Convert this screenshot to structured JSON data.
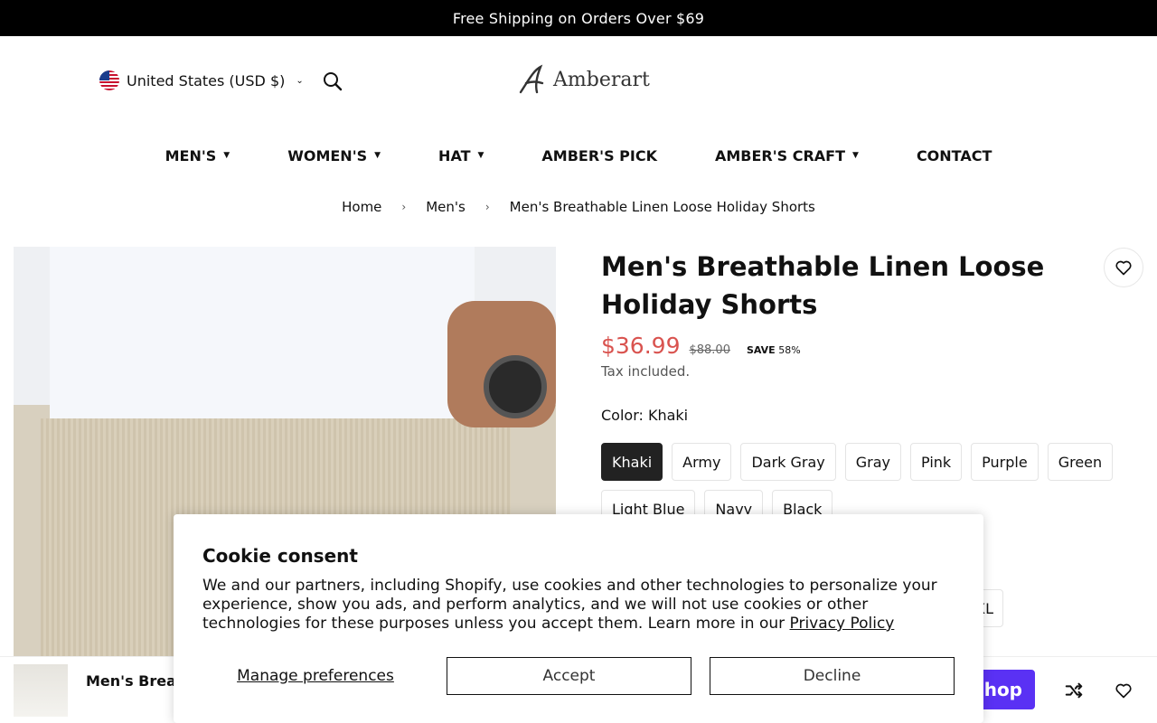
{
  "announcement": "Free Shipping on Orders Over $69",
  "header": {
    "country": "United States (USD $)",
    "logo_text": "Amberart"
  },
  "nav": [
    {
      "label": "MEN'S",
      "dropdown": true
    },
    {
      "label": "WOMEN'S",
      "dropdown": true
    },
    {
      "label": "HAT",
      "dropdown": true
    },
    {
      "label": "AMBER'S PICK",
      "dropdown": false
    },
    {
      "label": "AMBER'S CRAFT",
      "dropdown": true
    },
    {
      "label": "CONTACT",
      "dropdown": false
    }
  ],
  "breadcrumb": {
    "home": "Home",
    "category": "Men's",
    "current": "Men's Breathable Linen Loose Holiday Shorts"
  },
  "product": {
    "title": "Men's Breathable Linen Loose Holiday Shorts",
    "price": "$36.99",
    "compare_price": "$88.00",
    "save_label": "SAVE",
    "save_value": "58%",
    "tax_note": "Tax included.",
    "color_label": "Color: Khaki",
    "colors": [
      "Khaki",
      "Army",
      "Dark Gray",
      "Gray",
      "Pink",
      "Purple",
      "Green",
      "Light Blue",
      "Navy",
      "Black"
    ],
    "selected_color": "Khaki",
    "size_partial": "XL"
  },
  "sticky_bar": {
    "title": "Men's Breat",
    "shop_pay_label": "shop"
  },
  "cookie": {
    "heading": "Cookie consent",
    "body": "We and our partners, including Shopify, use cookies and other technologies to personalize your experience, show you ads, and perform analytics, and we will not use cookies or other technologies for these purposes unless you accept them. Learn more in our ",
    "link": "Privacy Policy",
    "manage": "Manage preferences",
    "accept": "Accept",
    "decline": "Decline"
  },
  "colors": {
    "price_red": "#d9534f",
    "shop_pay_purple": "#5a31f4"
  }
}
